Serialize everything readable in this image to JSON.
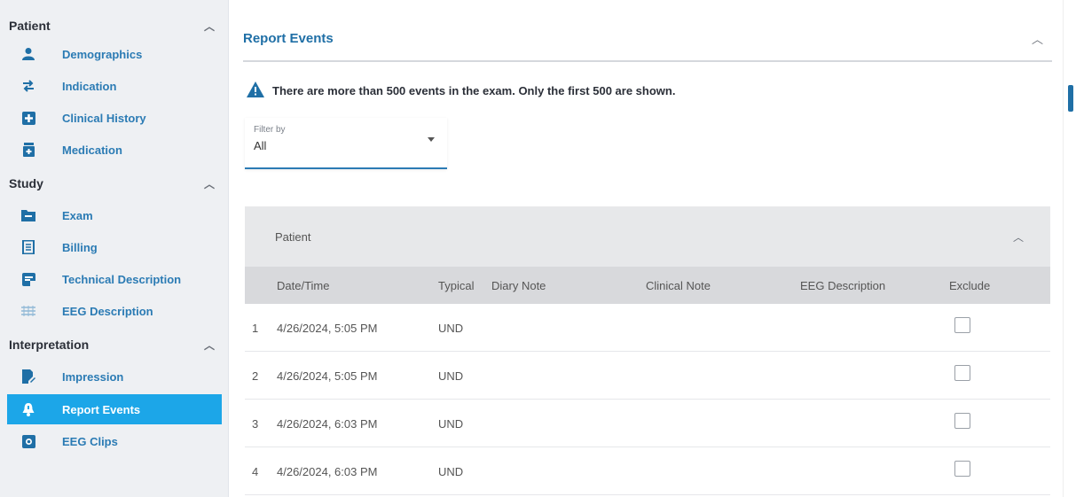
{
  "sidebar": {
    "sections": [
      {
        "title": "Patient",
        "items": [
          {
            "label": "Demographics",
            "icon": "person-icon"
          },
          {
            "label": "Indication",
            "icon": "arrows-icon"
          },
          {
            "label": "Clinical History",
            "icon": "medical-plus-icon"
          },
          {
            "label": "Medication",
            "icon": "medication-icon"
          }
        ]
      },
      {
        "title": "Study",
        "items": [
          {
            "label": "Exam",
            "icon": "folder-icon"
          },
          {
            "label": "Billing",
            "icon": "receipt-icon"
          },
          {
            "label": "Technical Description",
            "icon": "document-icon"
          },
          {
            "label": "EEG Description",
            "icon": "waveform-icon"
          }
        ]
      },
      {
        "title": "Interpretation",
        "items": [
          {
            "label": "Impression",
            "icon": "document-edit-icon"
          },
          {
            "label": "Report Events",
            "icon": "bell-icon",
            "active": true
          },
          {
            "label": "EEG Clips",
            "icon": "camera-icon"
          }
        ]
      }
    ]
  },
  "main": {
    "title": "Report Events",
    "warning": "There are more than 500 events in the exam. Only the first 500 are shown.",
    "filter": {
      "label": "Filter by",
      "value": "All"
    },
    "panel": {
      "title": "Patient"
    },
    "columns": [
      "Date/Time",
      "Typical",
      "Diary Note",
      "Clinical Note",
      "EEG Description",
      "Exclude"
    ],
    "rows": [
      {
        "num": "1",
        "datetime": "4/26/2024, 5:05 PM",
        "typical": "UND"
      },
      {
        "num": "2",
        "datetime": "4/26/2024, 5:05 PM",
        "typical": "UND"
      },
      {
        "num": "3",
        "datetime": "4/26/2024, 6:03 PM",
        "typical": "UND"
      },
      {
        "num": "4",
        "datetime": "4/26/2024, 6:03 PM",
        "typical": "UND"
      }
    ]
  },
  "colors": {
    "accent": "#1ca6e8",
    "link": "#2b7bb4",
    "sidebar_bg": "#eef0f3"
  }
}
